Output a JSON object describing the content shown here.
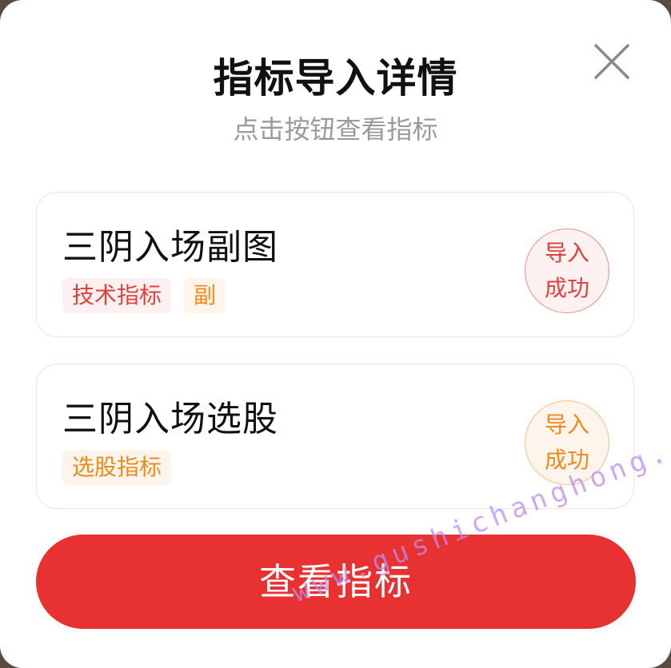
{
  "modal": {
    "title": "指标导入详情",
    "subtitle": "点击按钮查看指标",
    "close_icon": "close-icon"
  },
  "items": [
    {
      "name": "三阴入场副图",
      "tags": [
        "技术指标",
        "副"
      ],
      "status": {
        "line1": "导入",
        "line2": "成功"
      },
      "accent": "#e2413b"
    },
    {
      "name": "三阴入场选股",
      "tags": [
        "选股指标"
      ],
      "status": {
        "line1": "导入",
        "line2": "成功"
      },
      "accent": "#f08a1c"
    }
  ],
  "primary_button": {
    "label": "查看指标",
    "color": "#e83232"
  },
  "watermark": "www.gushichanghong.com"
}
